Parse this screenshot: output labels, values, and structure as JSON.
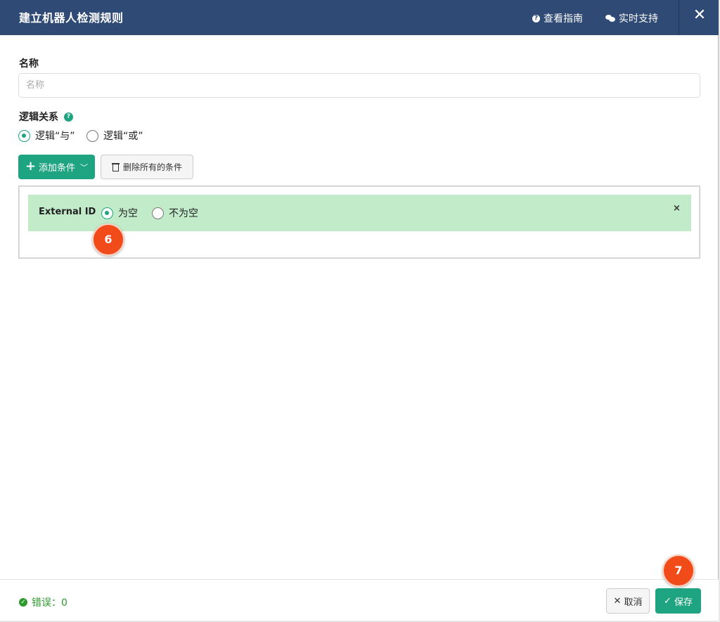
{
  "header": {
    "title": "建立机器人检测规则",
    "guide_label": "查看指南",
    "support_label": "实时支持",
    "close_glyph": "✕"
  },
  "form": {
    "name_label": "名称",
    "name_placeholder": "名称",
    "name_value": "",
    "logic_label": "逻辑关系",
    "logic_options": [
      {
        "label": "逻辑“与”",
        "selected": true
      },
      {
        "label": "逻辑“或”",
        "selected": false
      }
    ]
  },
  "actions": {
    "add_condition_label": "添加条件",
    "delete_all_label": "删除所有的条件"
  },
  "conditions": [
    {
      "field": "External ID",
      "options": [
        {
          "label": "为空",
          "selected": true
        },
        {
          "label": "不为空",
          "selected": false
        }
      ],
      "remove_glyph": "×"
    }
  ],
  "annotations": {
    "step_a": "6",
    "step_b": "7"
  },
  "footer": {
    "errors_label": "错误：0",
    "cancel_label": "取消",
    "save_label": "保存"
  },
  "colors": {
    "header_bg": "#2f4a74",
    "accent": "#1fa481",
    "condition_bg": "#c2ebca",
    "badge": "#f24b1a",
    "success": "#2e9a2e"
  }
}
